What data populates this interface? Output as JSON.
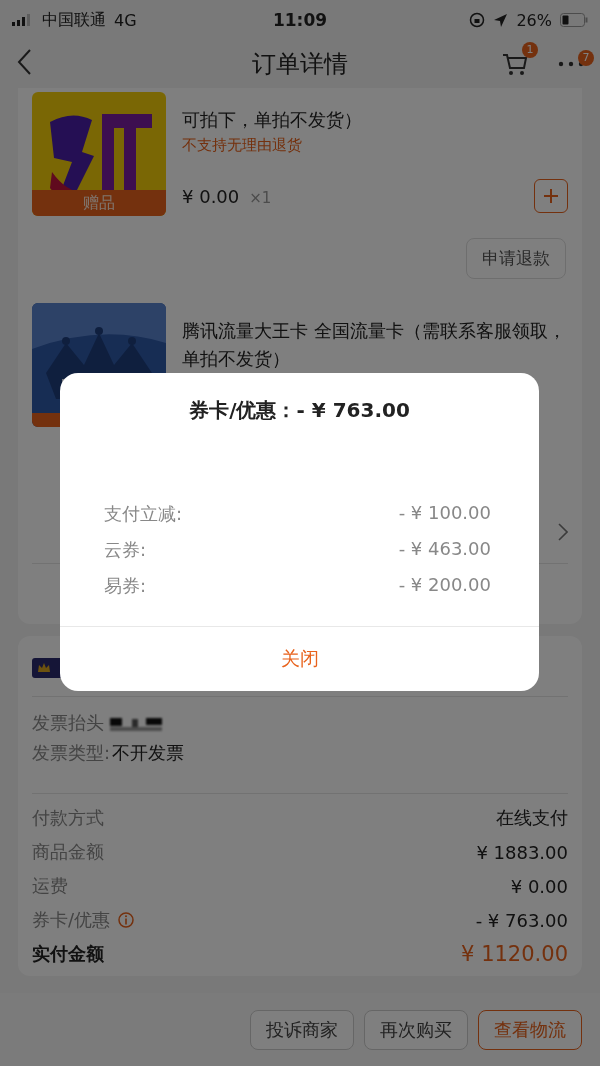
{
  "status_bar": {
    "carrier": "中国联通",
    "network": "4G",
    "time": "11:09",
    "battery": "26%"
  },
  "nav": {
    "title": "订单详情",
    "cart_badge": "1",
    "more_badge": "7"
  },
  "products": [
    {
      "title": "可拍下，单拍不发货）",
      "note": "不支持无理由退货",
      "tag": "赠品",
      "price": "¥ 0.00",
      "quantity": "×1",
      "action": "申请退款"
    },
    {
      "title": "腾讯流量大王卡 全国流量卡（需联系客服领取，单拍不发货）"
    }
  ],
  "invoice": {
    "title_label": "发票抬头",
    "type_label": "发票类型:",
    "type_value": "不开发票"
  },
  "summary": [
    {
      "kind": "plain",
      "label": "付款方式",
      "value": "在线支付"
    },
    {
      "kind": "plain",
      "label": "商品金额",
      "value": "¥ 1883.00"
    },
    {
      "kind": "plain",
      "label": "运费",
      "value": "¥ 0.00"
    },
    {
      "kind": "info",
      "label": "券卡/优惠",
      "value": "- ¥ 763.00"
    },
    {
      "kind": "total",
      "label": "实付金额",
      "value": "¥ 1120.00"
    }
  ],
  "buttons": [
    {
      "label": "投诉商家",
      "primary": false
    },
    {
      "label": "再次购买",
      "primary": false
    },
    {
      "label": "查看物流",
      "primary": true
    }
  ],
  "modal": {
    "title": "券卡/优惠：- ¥ 763.00",
    "rows": [
      {
        "label": "支付立减:",
        "value": "- ¥ 100.00"
      },
      {
        "label": "云券:",
        "value": "- ¥ 463.00"
      },
      {
        "label": "易券:",
        "value": "- ¥ 200.00"
      }
    ],
    "close": "关闭"
  }
}
